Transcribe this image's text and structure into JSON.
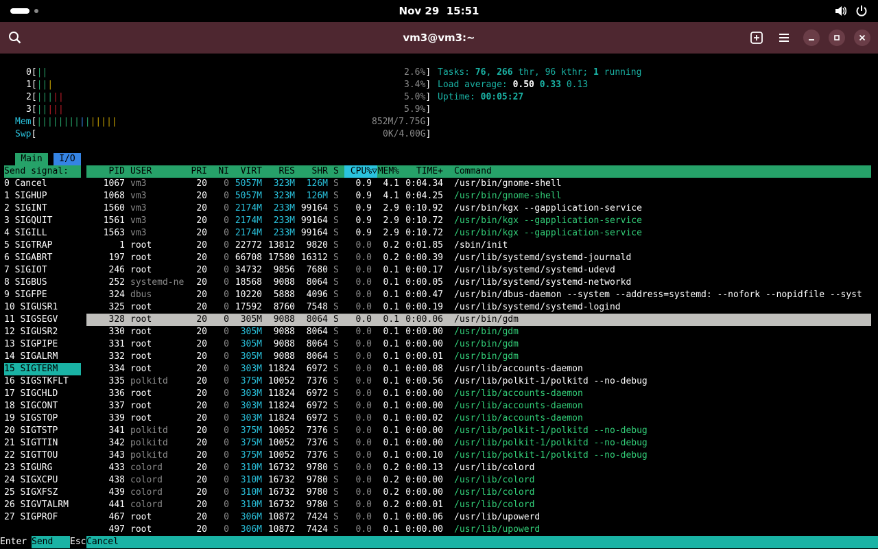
{
  "topbar": {
    "date": "Nov 29",
    "time": "15:51"
  },
  "window": {
    "title": "vm3@vm3:~"
  },
  "meters": {
    "cpus": [
      {
        "label": "0",
        "bars": "||",
        "pct": "2.6%"
      },
      {
        "label": "1",
        "bars": "|||",
        "pct": "3.4%"
      },
      {
        "label": "2",
        "bars": "|||||",
        "pct": "5.0%"
      },
      {
        "label": "3",
        "bars": "|||||",
        "pct": "5.9%"
      }
    ],
    "mem": {
      "label": "Mem",
      "bars": "||||||||||||||||",
      "value": "852M/7.75G"
    },
    "swp": {
      "label": "Swp",
      "value": "0K/4.00G"
    }
  },
  "stats": {
    "tasks_label": "Tasks:",
    "tasks": "76",
    "thr": "266",
    "thr_label": "thr,",
    "kthr": "96",
    "kthr_label": "kthr;",
    "running": "1",
    "running_label": "running",
    "load_label": "Load average:",
    "load1": "0.50",
    "load5": "0.33",
    "load15": "0.13",
    "uptime_label": "Uptime:",
    "uptime": "00:05:27"
  },
  "tabs": {
    "main": "Main",
    "io": "I/O"
  },
  "signal_panel": {
    "header": "Send signal:",
    "signals": [
      "0 Cancel",
      "1 SIGHUP",
      "2 SIGINT",
      "3 SIGQUIT",
      "4 SIGILL",
      "5 SIGTRAP",
      "6 SIGABRT",
      "7 SIGIOT",
      "8 SIGBUS",
      "9 SIGFPE",
      "10 SIGUSR1",
      "11 SIGSEGV",
      "12 SIGUSR2",
      "13 SIGPIPE",
      "14 SIGALRM",
      "15 SIGTERM",
      "16 SIGSTKFLT",
      "17 SIGCHLD",
      "18 SIGCONT",
      "19 SIGSTOP",
      "20 SIGTSTP",
      "21 SIGTTIN",
      "22 SIGTTOU",
      "23 SIGURG",
      "24 SIGXCPU",
      "25 SIGXFSZ",
      "26 SIGVTALRM",
      "27 SIGPROF"
    ],
    "selected_index": 15
  },
  "columns": {
    "pid": "PID",
    "user": "USER",
    "pri": "PRI",
    "ni": "NI",
    "virt": "VIRT",
    "res": "RES",
    "shr": "SHR",
    "s": "S",
    "cpu": "CPU%▽",
    "mem": "MEM%",
    "time": "TIME+",
    "cmd": "Command"
  },
  "processes": [
    {
      "pid": "1067",
      "user": "vm3",
      "pri": "20",
      "ni": "0",
      "virt": "5057M",
      "res": "323M",
      "shr": "126M",
      "s": "S",
      "cpu": "0.9",
      "mem": "4.1",
      "time": "0:04.34",
      "cmd": "/usr/bin/gnome-shell"
    },
    {
      "pid": "1068",
      "user": "vm3",
      "pri": "20",
      "ni": "0",
      "virt": "5057M",
      "res": "323M",
      "shr": "126M",
      "s": "S",
      "cpu": "0.9",
      "mem": "4.1",
      "time": "0:04.25",
      "cmd": "/usr/bin/gnome-shell"
    },
    {
      "pid": "1560",
      "user": "vm3",
      "pri": "20",
      "ni": "0",
      "virt": "2174M",
      "res": "233M",
      "shr": "99164",
      "s": "S",
      "cpu": "0.9",
      "mem": "2.9",
      "time": "0:10.92",
      "cmd": "/usr/bin/kgx --gapplication-service"
    },
    {
      "pid": "1561",
      "user": "vm3",
      "pri": "20",
      "ni": "0",
      "virt": "2174M",
      "res": "233M",
      "shr": "99164",
      "s": "S",
      "cpu": "0.9",
      "mem": "2.9",
      "time": "0:10.72",
      "cmd": "/usr/bin/kgx --gapplication-service"
    },
    {
      "pid": "1563",
      "user": "vm3",
      "pri": "20",
      "ni": "0",
      "virt": "2174M",
      "res": "233M",
      "shr": "99164",
      "s": "S",
      "cpu": "0.9",
      "mem": "2.9",
      "time": "0:10.72",
      "cmd": "/usr/bin/kgx --gapplication-service"
    },
    {
      "pid": "1",
      "user": "root",
      "pri": "20",
      "ni": "0",
      "virt": "22772",
      "res": "13812",
      "shr": "9820",
      "s": "S",
      "cpu": "0.0",
      "mem": "0.2",
      "time": "0:01.85",
      "cmd": "/sbin/init"
    },
    {
      "pid": "197",
      "user": "root",
      "pri": "20",
      "ni": "0",
      "virt": "66708",
      "res": "17580",
      "shr": "16312",
      "s": "S",
      "cpu": "0.0",
      "mem": "0.2",
      "time": "0:00.39",
      "cmd": "/usr/lib/systemd/systemd-journald"
    },
    {
      "pid": "246",
      "user": "root",
      "pri": "20",
      "ni": "0",
      "virt": "34732",
      "res": "9856",
      "shr": "7680",
      "s": "S",
      "cpu": "0.0",
      "mem": "0.1",
      "time": "0:00.17",
      "cmd": "/usr/lib/systemd/systemd-udevd"
    },
    {
      "pid": "252",
      "user": "systemd-ne",
      "pri": "20",
      "ni": "0",
      "virt": "18568",
      "res": "9088",
      "shr": "8064",
      "s": "S",
      "cpu": "0.0",
      "mem": "0.1",
      "time": "0:00.05",
      "cmd": "/usr/lib/systemd/systemd-networkd"
    },
    {
      "pid": "324",
      "user": "dbus",
      "pri": "20",
      "ni": "0",
      "virt": "10220",
      "res": "5888",
      "shr": "4096",
      "s": "S",
      "cpu": "0.0",
      "mem": "0.1",
      "time": "0:00.47",
      "cmd": "/usr/bin/dbus-daemon --system --address=systemd: --nofork --nopidfile --syst"
    },
    {
      "pid": "325",
      "user": "root",
      "pri": "20",
      "ni": "0",
      "virt": "17592",
      "res": "8760",
      "shr": "7548",
      "s": "S",
      "cpu": "0.0",
      "mem": "0.1",
      "time": "0:00.19",
      "cmd": "/usr/lib/systemd/systemd-logind"
    },
    {
      "pid": "328",
      "user": "root",
      "pri": "20",
      "ni": "0",
      "virt": "305M",
      "res": "9088",
      "shr": "8064",
      "s": "S",
      "cpu": "0.0",
      "mem": "0.1",
      "time": "0:00.06",
      "cmd": "/usr/bin/gdm"
    },
    {
      "pid": "330",
      "user": "root",
      "pri": "20",
      "ni": "0",
      "virt": "305M",
      "res": "9088",
      "shr": "8064",
      "s": "S",
      "cpu": "0.0",
      "mem": "0.1",
      "time": "0:00.00",
      "cmd": "/usr/bin/gdm"
    },
    {
      "pid": "331",
      "user": "root",
      "pri": "20",
      "ni": "0",
      "virt": "305M",
      "res": "9088",
      "shr": "8064",
      "s": "S",
      "cpu": "0.0",
      "mem": "0.1",
      "time": "0:00.00",
      "cmd": "/usr/bin/gdm"
    },
    {
      "pid": "332",
      "user": "root",
      "pri": "20",
      "ni": "0",
      "virt": "305M",
      "res": "9088",
      "shr": "8064",
      "s": "S",
      "cpu": "0.0",
      "mem": "0.1",
      "time": "0:00.01",
      "cmd": "/usr/bin/gdm"
    },
    {
      "pid": "334",
      "user": "root",
      "pri": "20",
      "ni": "0",
      "virt": "303M",
      "res": "11824",
      "shr": "6972",
      "s": "S",
      "cpu": "0.0",
      "mem": "0.1",
      "time": "0:00.08",
      "cmd": "/usr/lib/accounts-daemon"
    },
    {
      "pid": "335",
      "user": "polkitd",
      "pri": "20",
      "ni": "0",
      "virt": "375M",
      "res": "10052",
      "shr": "7376",
      "s": "S",
      "cpu": "0.0",
      "mem": "0.1",
      "time": "0:00.56",
      "cmd": "/usr/lib/polkit-1/polkitd --no-debug"
    },
    {
      "pid": "336",
      "user": "root",
      "pri": "20",
      "ni": "0",
      "virt": "303M",
      "res": "11824",
      "shr": "6972",
      "s": "S",
      "cpu": "0.0",
      "mem": "0.1",
      "time": "0:00.00",
      "cmd": "/usr/lib/accounts-daemon"
    },
    {
      "pid": "337",
      "user": "root",
      "pri": "20",
      "ni": "0",
      "virt": "303M",
      "res": "11824",
      "shr": "6972",
      "s": "S",
      "cpu": "0.0",
      "mem": "0.1",
      "time": "0:00.00",
      "cmd": "/usr/lib/accounts-daemon"
    },
    {
      "pid": "339",
      "user": "root",
      "pri": "20",
      "ni": "0",
      "virt": "303M",
      "res": "11824",
      "shr": "6972",
      "s": "S",
      "cpu": "0.0",
      "mem": "0.1",
      "time": "0:00.02",
      "cmd": "/usr/lib/accounts-daemon"
    },
    {
      "pid": "341",
      "user": "polkitd",
      "pri": "20",
      "ni": "0",
      "virt": "375M",
      "res": "10052",
      "shr": "7376",
      "s": "S",
      "cpu": "0.0",
      "mem": "0.1",
      "time": "0:00.00",
      "cmd": "/usr/lib/polkit-1/polkitd --no-debug"
    },
    {
      "pid": "342",
      "user": "polkitd",
      "pri": "20",
      "ni": "0",
      "virt": "375M",
      "res": "10052",
      "shr": "7376",
      "s": "S",
      "cpu": "0.0",
      "mem": "0.1",
      "time": "0:00.00",
      "cmd": "/usr/lib/polkit-1/polkitd --no-debug"
    },
    {
      "pid": "343",
      "user": "polkitd",
      "pri": "20",
      "ni": "0",
      "virt": "375M",
      "res": "10052",
      "shr": "7376",
      "s": "S",
      "cpu": "0.0",
      "mem": "0.1",
      "time": "0:00.10",
      "cmd": "/usr/lib/polkit-1/polkitd --no-debug"
    },
    {
      "pid": "433",
      "user": "colord",
      "pri": "20",
      "ni": "0",
      "virt": "310M",
      "res": "16732",
      "shr": "9780",
      "s": "S",
      "cpu": "0.0",
      "mem": "0.2",
      "time": "0:00.13",
      "cmd": "/usr/lib/colord"
    },
    {
      "pid": "438",
      "user": "colord",
      "pri": "20",
      "ni": "0",
      "virt": "310M",
      "res": "16732",
      "shr": "9780",
      "s": "S",
      "cpu": "0.0",
      "mem": "0.2",
      "time": "0:00.00",
      "cmd": "/usr/lib/colord"
    },
    {
      "pid": "439",
      "user": "colord",
      "pri": "20",
      "ni": "0",
      "virt": "310M",
      "res": "16732",
      "shr": "9780",
      "s": "S",
      "cpu": "0.0",
      "mem": "0.2",
      "time": "0:00.00",
      "cmd": "/usr/lib/colord"
    },
    {
      "pid": "441",
      "user": "colord",
      "pri": "20",
      "ni": "0",
      "virt": "310M",
      "res": "16732",
      "shr": "9780",
      "s": "S",
      "cpu": "0.0",
      "mem": "0.2",
      "time": "0:00.01",
      "cmd": "/usr/lib/colord"
    },
    {
      "pid": "467",
      "user": "root",
      "pri": "20",
      "ni": "0",
      "virt": "306M",
      "res": "10872",
      "shr": "7424",
      "s": "S",
      "cpu": "0.0",
      "mem": "0.1",
      "time": "0:00.06",
      "cmd": "/usr/lib/upowerd"
    },
    {
      "pid": "497",
      "user": "root",
      "pri": "20",
      "ni": "0",
      "virt": "306M",
      "res": "10872",
      "shr": "7424",
      "s": "S",
      "cpu": "0.0",
      "mem": "0.1",
      "time": "0:00.00",
      "cmd": "/usr/lib/upowerd"
    }
  ],
  "selected_process_index": 11,
  "footer": {
    "key1": "Enter",
    "label1": "Send",
    "key2": "Esc",
    "label2": "Cancel"
  },
  "colors": {
    "header_bg": "#26a269",
    "accent": "#1ab3a5",
    "titlebar": "#4e2730"
  }
}
